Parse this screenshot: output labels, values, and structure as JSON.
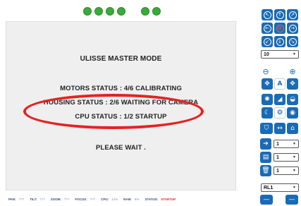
{
  "status_dots": [
    "on",
    "on",
    "on",
    "on",
    "on",
    "on"
  ],
  "main": {
    "title": "ULISSE MASTER MODE",
    "motors_status": "MOTORS STATUS :  4/6 CALIBRATING",
    "housing_status": "HOUSING STATUS :  2/6 WAITING FOR CAMERA",
    "cpu_status": "CPU STATUS :  1/2 STARTUP",
    "wait_message": "PLEASE WAIT ."
  },
  "status_bar": {
    "pan_label": "PAN:",
    "pan_value": "???",
    "tilt_label": "TILT:",
    "tilt_value": "???",
    "zoom_label": "ZOOM:",
    "zoom_value": "???",
    "focus_label": "FOCUS:",
    "focus_value": "???",
    "cpu_label": "CPU:",
    "cpu_value": "14%",
    "ram_label": "RAM:",
    "ram_value": "6%",
    "status_label": "STATUS:",
    "status_value": "STARTUP"
  },
  "controls": {
    "speed_select": "10",
    "preset_select_1": "1",
    "preset_select_2": "1",
    "preset_select_3": "1",
    "mode_select": "RL1"
  },
  "colors": {
    "accent": "#1a6bb5",
    "status_dot": "#3aaa3a",
    "alert": "#e52222"
  }
}
